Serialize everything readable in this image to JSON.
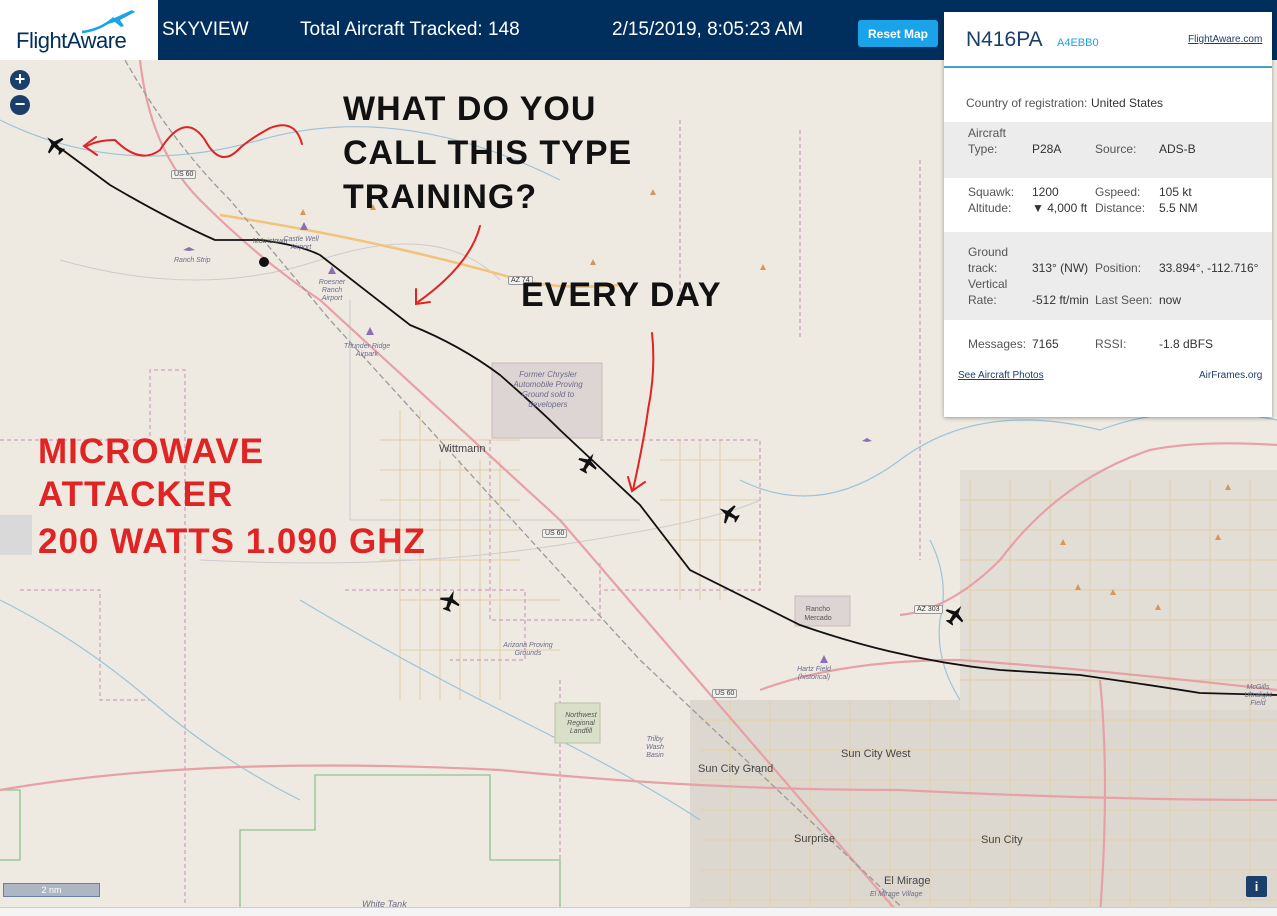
{
  "app": {
    "logo_text": "FlightAware",
    "view_name": "SKYVIEW",
    "aircraft_tracked": "Total Aircraft Tracked: 148",
    "datetime": "2/15/2019, 8:05:23 AM",
    "reset_label": "Reset Map",
    "brand_color": "#002f5d",
    "accent_color": "#1aa3e8"
  },
  "map": {
    "zoom_in": "+",
    "zoom_out": "−",
    "scale_label": "2 nm",
    "info_label": "i",
    "places": {
      "morristown": "Morristown",
      "castle_well": "Castle Well Airport",
      "ranch_strip": "Ranch Strip",
      "roesner": "Roesner Ranch Airport",
      "thunder_ridge": "Thunder Ridge Airpark",
      "chrysler": "Former Chrysler Automobile Proving Ground sold to developers",
      "wittmann": "Wittmann",
      "rancho_mercado": "Rancho Mercado",
      "arizona_proving": "Arizona Proving Grounds",
      "landfill": "Northwest Regional Landfill",
      "trilby": "Trilby Wash Basin",
      "hartz": "Hartz Field (historical)",
      "sun_city_grand": "Sun City Grand",
      "sun_city_west": "Sun City West",
      "surprise": "Surprise",
      "sun_city": "Sun City",
      "el_mirage": "El Mirage",
      "el_mirage_village": "El Mirage Village",
      "mcgills": "McGills Ultralight Field",
      "white_tank": "White Tank"
    },
    "shields": {
      "us60_a": "US 60",
      "az74": "AZ 74",
      "us60_b": "US 60",
      "us60_c": "US 60",
      "az303": "AZ 303"
    }
  },
  "annotations": {
    "question": [
      "WHAT DO YOU",
      "CALL THIS TYPE",
      "TRAINING?"
    ],
    "every_day": "EVERY DAY",
    "attacker": [
      "MICROWAVE",
      "ATTACKER",
      "200 WATTS 1.090 GHZ"
    ]
  },
  "panel": {
    "registration": "N416PA",
    "hex": "A4EBB0",
    "fa_link": "FlightAware.com",
    "country_label": "Country of registration:",
    "country_value": "United States",
    "aircraft_type_label": [
      "Aircraft",
      "Type:"
    ],
    "aircraft_type_value": "P28A",
    "source_label": "Source:",
    "source_value": "ADS-B",
    "squawk_label": "Squawk:",
    "squawk_value": "1200",
    "altitude_label": "Altitude:",
    "altitude_value": "▼ 4,000 ft",
    "gspeed_label": "Gspeed:",
    "gspeed_value": "105 kt",
    "distance_label": "Distance:",
    "distance_value": "5.5 NM",
    "ground_track_label": [
      "Ground",
      "track:"
    ],
    "ground_track_value": "313° (NW)",
    "position_label": "Position:",
    "position_value": "33.894°, -112.716°",
    "vertical_rate_label": [
      "Vertical",
      "Rate:"
    ],
    "vertical_rate_value": "-512 ft/min",
    "last_seen_label": "Last Seen:",
    "last_seen_value": "now",
    "messages_label": "Messages:",
    "messages_value": "7165",
    "rssi_label": "RSSI:",
    "rssi_value": "-1.8 dBFS",
    "photos_link": "See Aircraft Photos",
    "airframes_link": "AirFrames.org"
  }
}
